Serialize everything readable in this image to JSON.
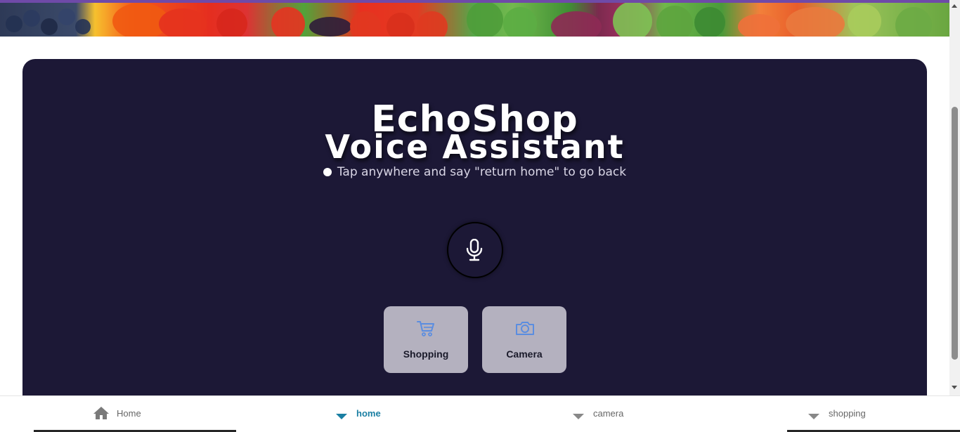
{
  "app": {
    "title_line1": "EchoShop",
    "title_line2": "Voice Assistant",
    "hint": "Tap anywhere and say \"return home\" to go back"
  },
  "actions": [
    {
      "label": "Shopping",
      "icon": "shopping-cart-icon"
    },
    {
      "label": "Camera",
      "icon": "camera-icon"
    }
  ],
  "bottom_nav": {
    "home_label": "Home",
    "tabs": [
      {
        "label": "home",
        "active": true
      },
      {
        "label": "camera",
        "active": false
      },
      {
        "label": "shopping",
        "active": false
      }
    ]
  },
  "colors": {
    "panel_bg": "#1c1836",
    "card_bg": "#b4b1bf",
    "accent_blue": "#1a7fa3",
    "icon_blue": "#5b8de0",
    "top_stripe": "#6f4aa8"
  }
}
